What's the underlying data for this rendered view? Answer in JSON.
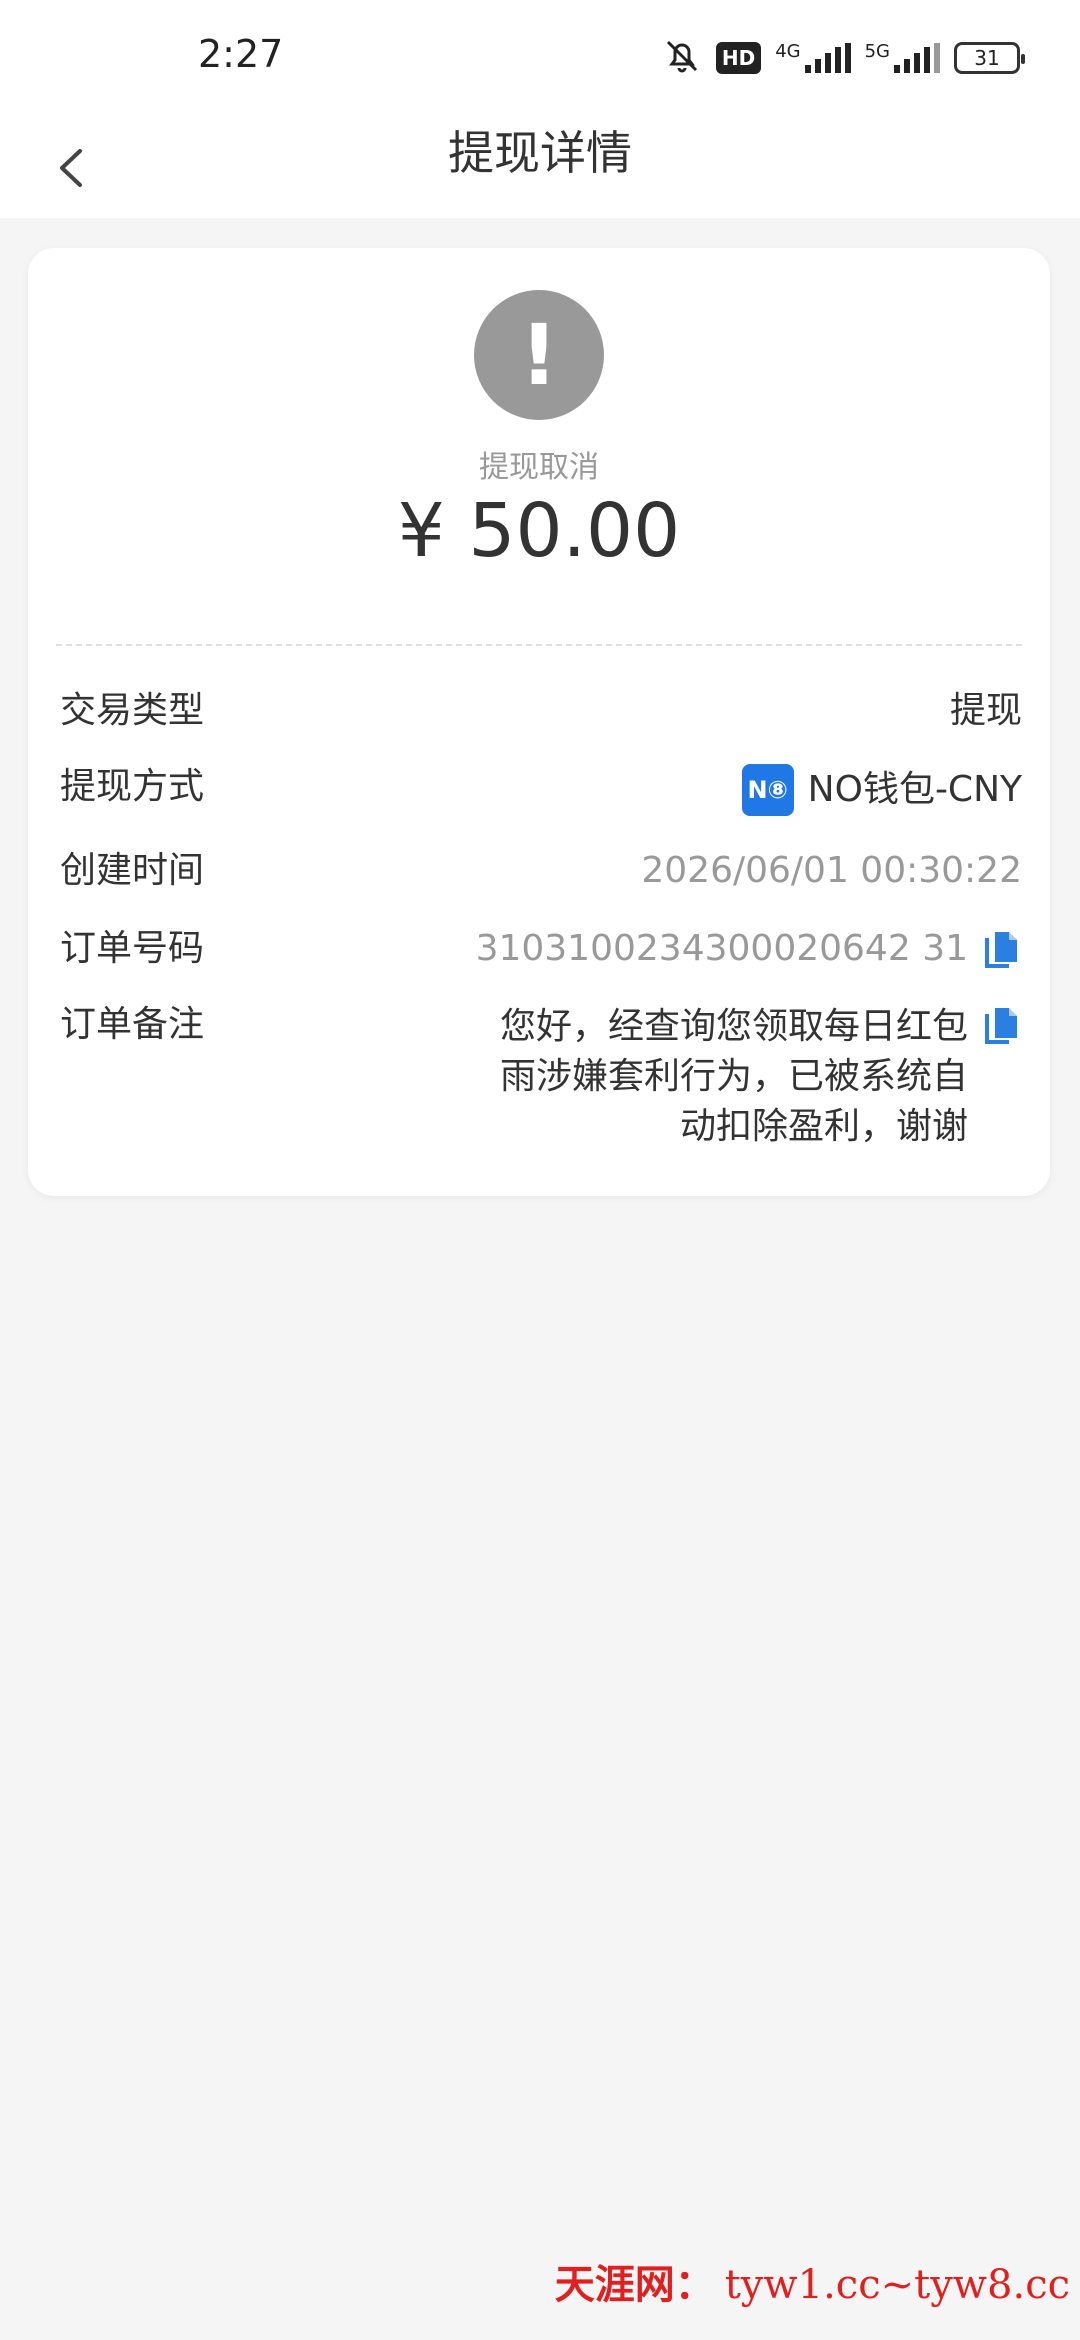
{
  "status_bar": {
    "time": "2:27",
    "hd_label": "HD",
    "net1": "4G",
    "net2": "5G",
    "battery": "31"
  },
  "header": {
    "title": "提现详情"
  },
  "summary": {
    "status": "提现取消",
    "amount": "¥ 50.00",
    "status_color": "#999999"
  },
  "details": {
    "type_label": "交易类型",
    "type_value": "提现",
    "method_label": "提现方式",
    "method_badge": "N⑧",
    "method_value": "NO钱包-CNY",
    "created_label": "创建时间",
    "created_value": "2026/06/01 00:30:22",
    "order_label": "订单号码",
    "order_value": "3103100234300020642 31",
    "remark_label": "订单备注",
    "remark_value": "您好，经查询您领取每日红包雨涉嫌套利行为，已被系统自动扣除盈利，谢谢"
  },
  "watermark": {
    "name": "天涯网：",
    "domains": "tyw1.cc~tyw8.cc"
  },
  "colors": {
    "accent": "#1f78e5",
    "watermark": "#e21f1f"
  }
}
